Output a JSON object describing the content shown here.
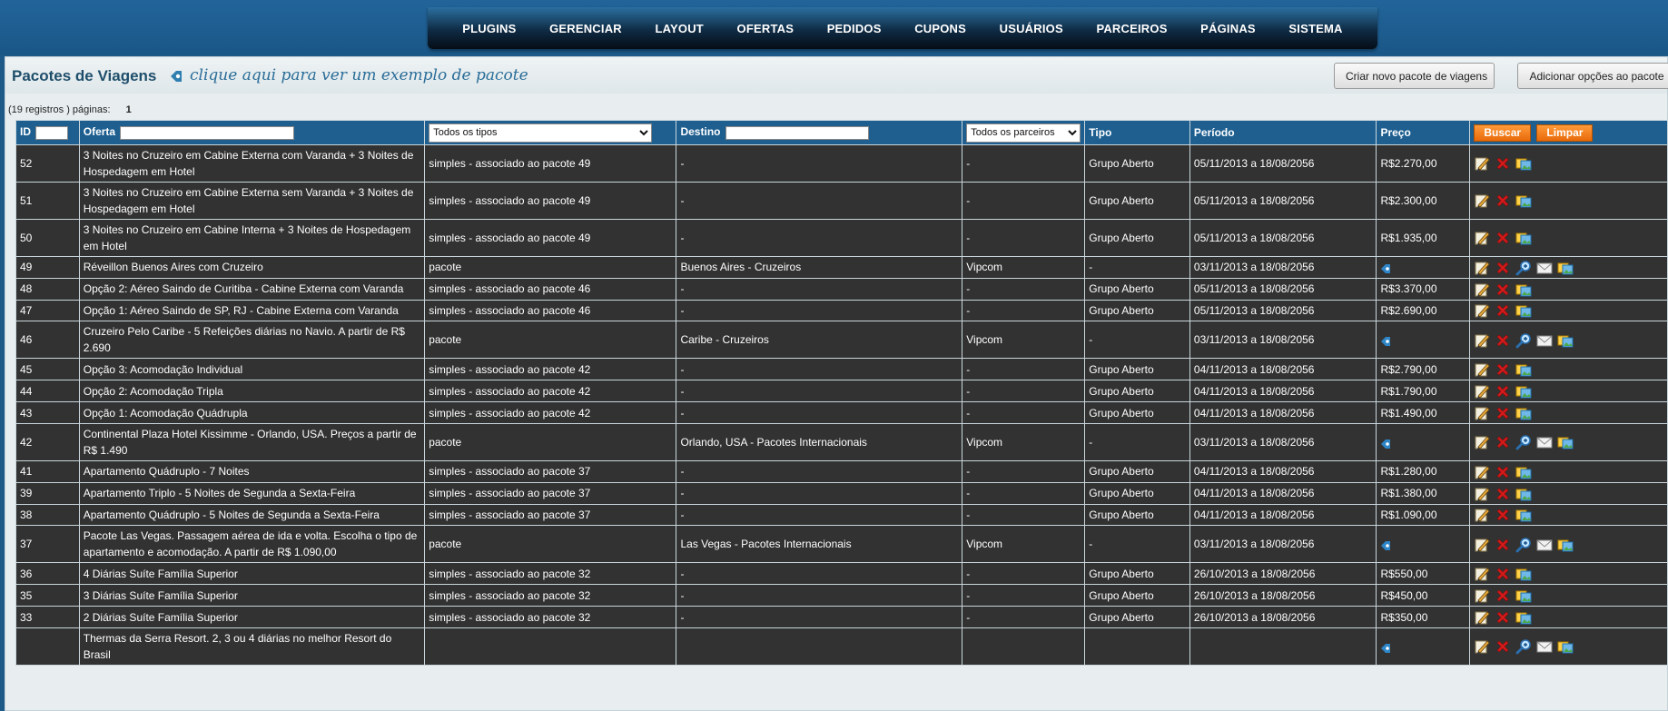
{
  "nav": {
    "items": [
      "PLUGINS",
      "GERENCIAR",
      "LAYOUT",
      "OFERTAS",
      "PEDIDOS",
      "CUPONS",
      "USUÁRIOS",
      "PARCEIROS",
      "PÁGINAS",
      "SISTEMA"
    ]
  },
  "header": {
    "title": "Pacotes de Viagens",
    "example_link": "clique aqui para ver um exemplo de pacote",
    "new_package_button": "Criar novo pacote de viagens",
    "add_options_button": "Adicionar opções ao pacote"
  },
  "records": {
    "summary": "(19 registros ) páginas:",
    "pages": "1"
  },
  "table": {
    "columns": {
      "id": "ID",
      "oferta": "Oferta",
      "destino": "Destino",
      "tipo": "Tipo",
      "periodo": "Período",
      "preco": "Preço"
    },
    "type_filter_selected": "Todos os tipos",
    "partner_filter_selected": "Todos os parceiros",
    "search_button": "Buscar",
    "clear_button": "Limpar",
    "rows": [
      {
        "id": "52",
        "oferta": "3 Noites no Cruzeiro em Cabine Externa com Varanda + 3 Noites de Hospedagem em Hotel",
        "tipo_oferta": "simples - associado ao pacote 49",
        "destino": "-",
        "parceiro": "-",
        "tipo": "Grupo Aberto",
        "periodo": "05/11/2013 a 18/08/2056",
        "preco": "R$2.270,00",
        "kind": "simples"
      },
      {
        "id": "51",
        "oferta": "3 Noites no Cruzeiro em Cabine Externa sem Varanda + 3 Noites de Hospedagem em Hotel",
        "tipo_oferta": "simples - associado ao pacote 49",
        "destino": "-",
        "parceiro": "-",
        "tipo": "Grupo Aberto",
        "periodo": "05/11/2013 a 18/08/2056",
        "preco": "R$2.300,00",
        "kind": "simples"
      },
      {
        "id": "50",
        "oferta": "3 Noites no Cruzeiro em Cabine Interna + 3 Noites de Hospedagem em Hotel",
        "tipo_oferta": "simples - associado ao pacote 49",
        "destino": "-",
        "parceiro": "-",
        "tipo": "Grupo Aberto",
        "periodo": "05/11/2013 a 18/08/2056",
        "preco": "R$1.935,00",
        "kind": "simples"
      },
      {
        "id": "49",
        "oferta": "Réveillon Buenos Aires com Cruzeiro",
        "tipo_oferta": "pacote",
        "destino": "Buenos Aires - Cruzeiros",
        "parceiro": "Vipcom",
        "tipo": "-",
        "periodo": "03/11/2013 a 18/08/2056",
        "preco": "",
        "kind": "pacote"
      },
      {
        "id": "48",
        "oferta": "Opção 2: Aéreo Saindo de Curitiba - Cabine Externa com Varanda",
        "tipo_oferta": "simples - associado ao pacote 46",
        "destino": "-",
        "parceiro": "-",
        "tipo": "Grupo Aberto",
        "periodo": "05/11/2013 a 18/08/2056",
        "preco": "R$3.370,00",
        "kind": "simples"
      },
      {
        "id": "47",
        "oferta": "Opção 1: Aéreo Saindo de SP, RJ - Cabine Externa com Varanda",
        "tipo_oferta": "simples - associado ao pacote 46",
        "destino": "-",
        "parceiro": "-",
        "tipo": "Grupo Aberto",
        "periodo": "05/11/2013 a 18/08/2056",
        "preco": "R$2.690,00",
        "kind": "simples"
      },
      {
        "id": "46",
        "oferta": "Cruzeiro Pelo Caribe - 5 Refeições diárias no Navio. A partir de R$ 2.690",
        "tipo_oferta": "pacote",
        "destino": "Caribe - Cruzeiros",
        "parceiro": "Vipcom",
        "tipo": "-",
        "periodo": "03/11/2013 a 18/08/2056",
        "preco": "",
        "kind": "pacote"
      },
      {
        "id": "45",
        "oferta": "Opção 3: Acomodação Individual",
        "tipo_oferta": "simples - associado ao pacote 42",
        "destino": "-",
        "parceiro": "-",
        "tipo": "Grupo Aberto",
        "periodo": "04/11/2013 a 18/08/2056",
        "preco": "R$2.790,00",
        "kind": "simples"
      },
      {
        "id": "44",
        "oferta": "Opção 2: Acomodação Tripla",
        "tipo_oferta": "simples - associado ao pacote 42",
        "destino": "-",
        "parceiro": "-",
        "tipo": "Grupo Aberto",
        "periodo": "04/11/2013 a 18/08/2056",
        "preco": "R$1.790,00",
        "kind": "simples"
      },
      {
        "id": "43",
        "oferta": "Opção 1: Acomodação Quádrupla",
        "tipo_oferta": "simples - associado ao pacote 42",
        "destino": "-",
        "parceiro": "-",
        "tipo": "Grupo Aberto",
        "periodo": "04/11/2013 a 18/08/2056",
        "preco": "R$1.490,00",
        "kind": "simples"
      },
      {
        "id": "42",
        "oferta": "Continental Plaza Hotel Kissimme - Orlando, USA. Preços a partir de R$ 1.490",
        "tipo_oferta": "pacote",
        "destino": "Orlando, USA - Pacotes Internacionais",
        "parceiro": "Vipcom",
        "tipo": "-",
        "periodo": "03/11/2013 a 18/08/2056",
        "preco": "",
        "kind": "pacote"
      },
      {
        "id": "41",
        "oferta": "Apartamento Quádruplo - 7 Noites",
        "tipo_oferta": "simples - associado ao pacote 37",
        "destino": "-",
        "parceiro": "-",
        "tipo": "Grupo Aberto",
        "periodo": "04/11/2013 a 18/08/2056",
        "preco": "R$1.280,00",
        "kind": "simples"
      },
      {
        "id": "39",
        "oferta": "Apartamento Triplo - 5 Noites de Segunda a Sexta-Feira",
        "tipo_oferta": "simples - associado ao pacote 37",
        "destino": "-",
        "parceiro": "-",
        "tipo": "Grupo Aberto",
        "periodo": "04/11/2013 a 18/08/2056",
        "preco": "R$1.380,00",
        "kind": "simples"
      },
      {
        "id": "38",
        "oferta": "Apartamento Quádruplo - 5 Noites de Segunda a Sexta-Feira",
        "tipo_oferta": "simples - associado ao pacote 37",
        "destino": "-",
        "parceiro": "-",
        "tipo": "Grupo Aberto",
        "periodo": "04/11/2013 a 18/08/2056",
        "preco": "R$1.090,00",
        "kind": "simples"
      },
      {
        "id": "37",
        "oferta": "Pacote Las Vegas. Passagem aérea de ida e volta. Escolha o tipo de apartamento e acomodação. A partir de R$ 1.090,00",
        "tipo_oferta": "pacote",
        "destino": "Las Vegas - Pacotes Internacionais",
        "parceiro": "Vipcom",
        "tipo": "-",
        "periodo": "03/11/2013 a 18/08/2056",
        "preco": "",
        "kind": "pacote"
      },
      {
        "id": "36",
        "oferta": "4 Diárias Suíte Família Superior",
        "tipo_oferta": "simples - associado ao pacote 32",
        "destino": "-",
        "parceiro": "-",
        "tipo": "Grupo Aberto",
        "periodo": "26/10/2013 a 18/08/2056",
        "preco": "R$550,00",
        "kind": "simples"
      },
      {
        "id": "35",
        "oferta": "3 Diárias Suíte Família Superior",
        "tipo_oferta": "simples - associado ao pacote 32",
        "destino": "-",
        "parceiro": "-",
        "tipo": "Grupo Aberto",
        "periodo": "26/10/2013 a 18/08/2056",
        "preco": "R$450,00",
        "kind": "simples"
      },
      {
        "id": "33",
        "oferta": "2 Diárias Suíte Família Superior",
        "tipo_oferta": "simples - associado ao pacote 32",
        "destino": "-",
        "parceiro": "-",
        "tipo": "Grupo Aberto",
        "periodo": "26/10/2013 a 18/08/2056",
        "preco": "R$350,00",
        "kind": "simples"
      },
      {
        "id": "",
        "oferta": "Thermas da Serra Resort. 2, 3 ou 4 diárias no melhor Resort do Brasil",
        "tipo_oferta": "",
        "destino": "",
        "parceiro": "",
        "tipo": "",
        "periodo": "",
        "preco": "",
        "kind": "pacote"
      }
    ]
  },
  "icons": {
    "edit": "pencil-edit-icon",
    "delete": "red-x-delete-icon",
    "view": "magnifier-icon",
    "email": "envelope-icon",
    "options": "photo-frames-icon",
    "info": "blue-gem-icon"
  },
  "colors": {
    "nav_bg": "#1d5a88",
    "header_row": "#1e5f90",
    "row_bg": "#323232",
    "button_orange": "#f07a14",
    "title": "#1f4e6b"
  }
}
